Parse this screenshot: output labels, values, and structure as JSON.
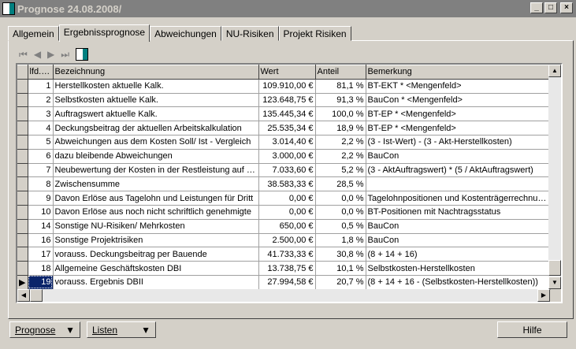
{
  "window": {
    "title": "Prognose 24.08.2008/",
    "minimize": "_",
    "maximize": "□",
    "close": "×"
  },
  "tabs": [
    "Allgemein",
    "Ergebnissprognose",
    "Abweichungen",
    "NU-Risiken",
    "Projekt Risiken"
  ],
  "toolbar": {
    "first": "⏮",
    "prev": "◀",
    "next": "▶",
    "last": "⏭"
  },
  "columns": [
    "",
    "lfd.Nr.",
    "Bezeichnung",
    "Wert",
    "Anteil",
    "Bemerkung"
  ],
  "rows": [
    [
      "1",
      "Herstellkosten aktuelle Kalk.",
      "109.910,00 €",
      "81,1 %",
      "BT-EKT * <Mengenfeld>"
    ],
    [
      "2",
      "Selbstkosten aktuelle Kalk.",
      "123.648,75 €",
      "91,3 %",
      "BauCon * <Mengenfeld>"
    ],
    [
      "3",
      "Auftragswert aktuelle Kalk.",
      "135.445,34 €",
      "100,0 %",
      "BT-EP * <Mengenfeld>"
    ],
    [
      "4",
      "Deckungsbeitrag der aktuellen Arbeitskalkulation",
      "25.535,34 €",
      "18,9 %",
      "BT-EP * <Mengenfeld>"
    ],
    [
      "5",
      "Abweichungen aus dem Kosten Soll/ Ist - Vergleich",
      "3.014,40 €",
      "2,2 %",
      "(3 - Ist-Wert) - (3 - Akt-Herstellkosten)"
    ],
    [
      "6",
      "dazu bleibende Abweichungen",
      "3.000,00 €",
      "2,2 %",
      "BauCon"
    ],
    [
      "7",
      "Neubewertung der Kosten in der Restleistung auf Ba",
      "7.033,60 €",
      "5,2 %",
      "(3 - AktAuftragswert) * (5 / AktAuftragswert)"
    ],
    [
      "8",
      "Zwischensumme",
      "38.583,33 €",
      "28,5 %",
      ""
    ],
    [
      "9",
      "Davon Erlöse aus Tagelohn und Leistungen für Dritt",
      "0,00 €",
      "0,0 %",
      "Tagelohnpositionen und Kostenträgerrechnun..."
    ],
    [
      "10",
      "Davon Erlöse aus noch nicht schriftlich genehmigte",
      "0,00 €",
      "0,0 %",
      "BT-Positionen mit Nachtragsstatus"
    ],
    [
      "14",
      "Sonstige NU-Risiken/ Mehrkosten",
      "650,00 €",
      "0,5 %",
      "BauCon"
    ],
    [
      "16",
      "Sonstige Projektrisiken",
      "2.500,00 €",
      "1,8 %",
      "BauCon"
    ],
    [
      "17",
      "vorauss. Deckungsbeitrag per Bauende",
      "41.733,33 €",
      "30,8 %",
      "(8 + 14 + 16)"
    ],
    [
      "18",
      "Allgemeine Geschäftskosten DBI",
      "13.738,75 €",
      "10,1 %",
      "Selbstkosten-Herstellkosten"
    ],
    [
      "19",
      "vorauss. Ergebnis DBII",
      "27.994,58 €",
      "20,7 %",
      "(8 + 14 + 16 - (Selbstkosten-Herstellkosten))"
    ]
  ],
  "buttons": {
    "prognose": "Prognose",
    "listen": "Listen",
    "hilfe": "Hilfe"
  }
}
